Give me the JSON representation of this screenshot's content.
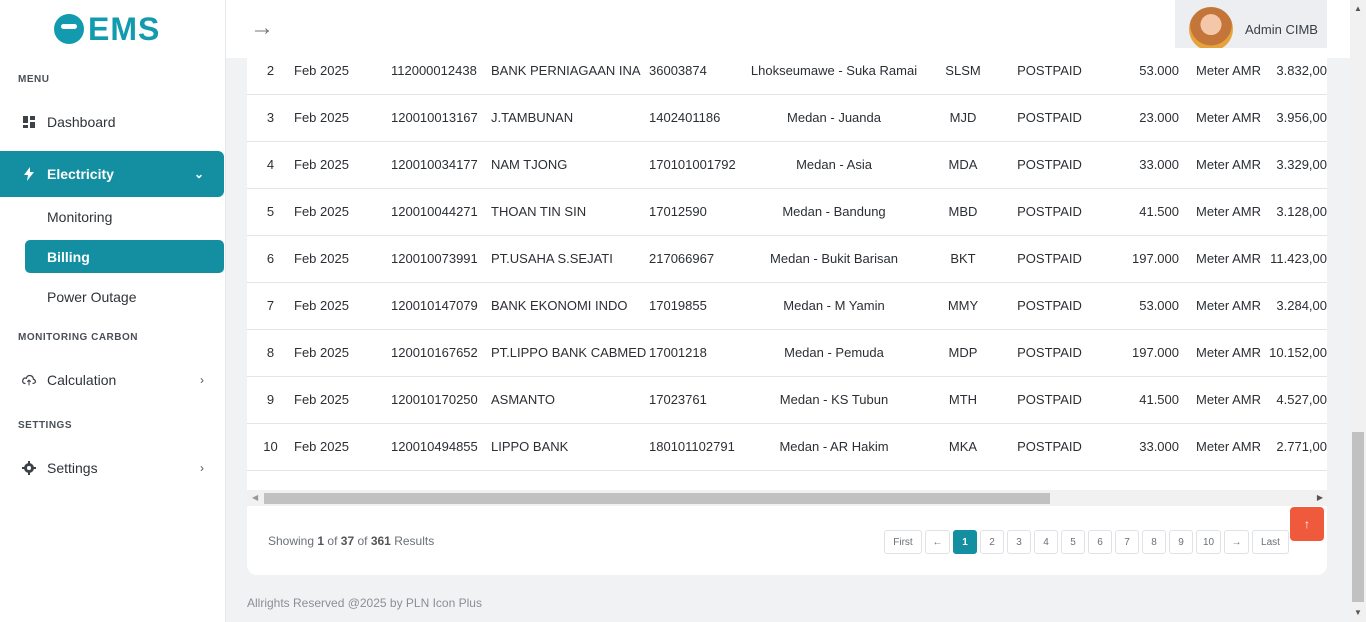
{
  "brand": {
    "name": "EMS"
  },
  "sidebar": {
    "menu_label": "MENU",
    "dashboard": "Dashboard",
    "electricity": "Electricity",
    "monitoring": "Monitoring",
    "billing": "Billing",
    "power_outage": "Power Outage",
    "monitoring_carbon_label": "MONITORING CARBON",
    "calculation": "Calculation",
    "settings_label": "SETTINGS",
    "settings": "Settings"
  },
  "topbar": {
    "back_icon": "arrow-right-icon",
    "user_name": "Admin CIMB"
  },
  "table": {
    "rows": [
      [
        "2",
        "Feb 2025",
        "112000012438",
        "BANK PERNIAGAAN INA",
        "36003874",
        "Lhokseumawe - Suka Ramai",
        "SLSM",
        "POSTPAID",
        "53.000",
        "Meter AMR",
        "3.832,00"
      ],
      [
        "3",
        "Feb 2025",
        "120010013167",
        "J.TAMBUNAN",
        "1402401186",
        "Medan - Juanda",
        "MJD",
        "POSTPAID",
        "23.000",
        "Meter AMR",
        "3.956,00"
      ],
      [
        "4",
        "Feb 2025",
        "120010034177",
        "NAM TJONG",
        "170101001792",
        "Medan - Asia",
        "MDA",
        "POSTPAID",
        "33.000",
        "Meter AMR",
        "3.329,00"
      ],
      [
        "5",
        "Feb 2025",
        "120010044271",
        "THOAN TIN SIN",
        "17012590",
        "Medan - Bandung",
        "MBD",
        "POSTPAID",
        "41.500",
        "Meter AMR",
        "3.128,00"
      ],
      [
        "6",
        "Feb 2025",
        "120010073991",
        "PT.USAHA S.SEJATI",
        "217066967",
        "Medan - Bukit Barisan",
        "BKT",
        "POSTPAID",
        "197.000",
        "Meter AMR",
        "11.423,00"
      ],
      [
        "7",
        "Feb 2025",
        "120010147079",
        "BANK EKONOMI INDO",
        "17019855",
        "Medan - M Yamin",
        "MMY",
        "POSTPAID",
        "53.000",
        "Meter AMR",
        "3.284,00"
      ],
      [
        "8",
        "Feb 2025",
        "120010167652",
        "PT.LIPPO BANK CABMED",
        "17001218",
        "Medan - Pemuda",
        "MDP",
        "POSTPAID",
        "197.000",
        "Meter AMR",
        "10.152,00"
      ],
      [
        "9",
        "Feb 2025",
        "120010170250",
        "ASMANTO",
        "17023761",
        "Medan - KS Tubun",
        "MTH",
        "POSTPAID",
        "41.500",
        "Meter AMR",
        "4.527,00"
      ],
      [
        "10",
        "Feb 2025",
        "120010494855",
        "LIPPO BANK",
        "180101102791",
        "Medan - AR Hakim",
        "MKA",
        "POSTPAID",
        "33.000",
        "Meter AMR",
        "2.771,00"
      ]
    ]
  },
  "pagination": {
    "showing_prefix": "Showing",
    "current": "1",
    "of1": "of",
    "total_pages": "37",
    "of2": "of",
    "total_results": "361",
    "results": "Results",
    "first": "First",
    "prev": "←",
    "pages": [
      "1",
      "2",
      "3",
      "4",
      "5",
      "6",
      "7",
      "8",
      "9",
      "10"
    ],
    "next": "→",
    "last": "Last"
  },
  "footer": {
    "text": "Allrights Reserved @2025 by PLN Icon Plus"
  },
  "colors": {
    "accent": "#138fa1",
    "scroll_top": "#f05a3c"
  }
}
